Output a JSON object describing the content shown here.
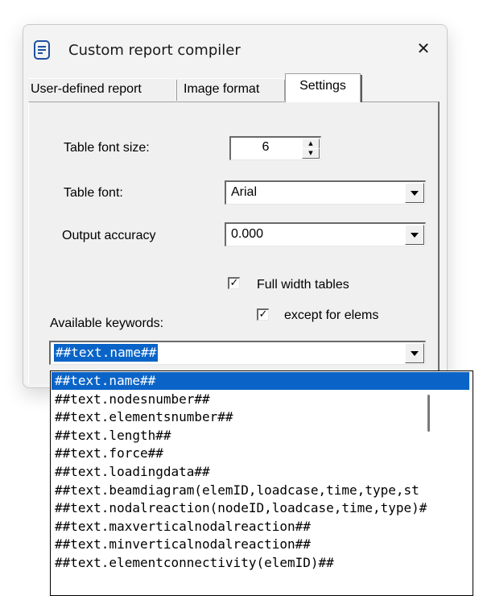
{
  "window": {
    "title": "Custom report compiler",
    "close_glyph": "✕",
    "icon": "document-icon"
  },
  "tabs": [
    {
      "label": "User-defined report",
      "active": false
    },
    {
      "label": "Image format",
      "active": false
    },
    {
      "label": "Settings",
      "active": true
    }
  ],
  "settings": {
    "table_font_size_label": "Table font size:",
    "table_font_size_value": "6",
    "table_font_label": "Table font:",
    "table_font_value": "Arial",
    "output_accuracy_label": "Output accuracy",
    "output_accuracy_value": "0.000",
    "full_width_label": "Full width tables",
    "full_width_checked": true,
    "except_elems_label": "except for elems",
    "except_elems_checked": true,
    "keywords_label": "Available keywords:",
    "keywords_value": "##text.name##"
  },
  "keywords_list": [
    "##text.name##",
    "##text.nodesnumber##",
    "##text.elementsnumber##",
    "##text.length##",
    "##text.force##",
    "##text.loadingdata##",
    "##text.beamdiagram(elemID,loadcase,time,type,st",
    "##text.nodalreaction(nodeID,loadcase,time,type)#",
    "##text.maxverticalnodalreaction##",
    "##text.minverticalnodalreaction##",
    "##text.elementconnectivity(elemID)##"
  ],
  "selected_keyword_index": 0,
  "colors": {
    "selection": "#0a64c8",
    "window_bg": "#f3f3f3"
  }
}
